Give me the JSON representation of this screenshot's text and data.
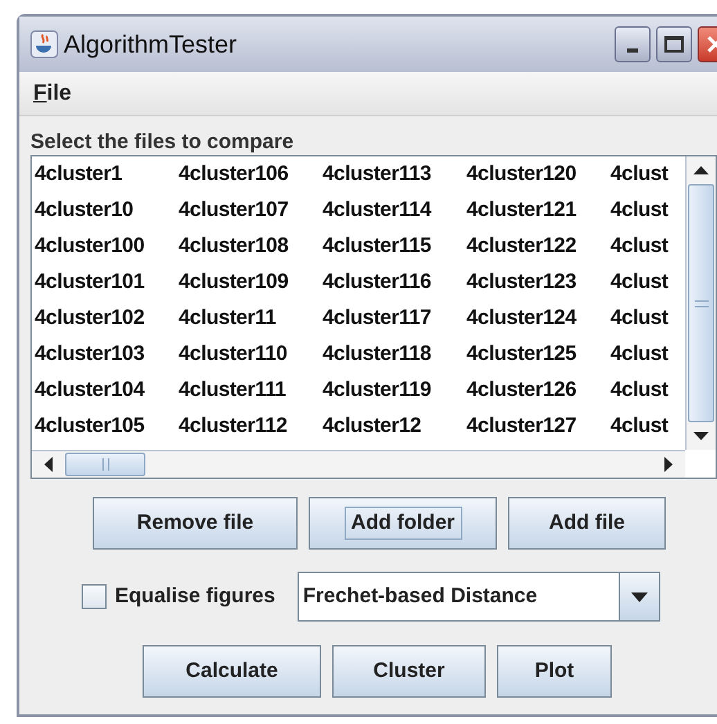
{
  "window": {
    "title": "AlgorithmTester"
  },
  "menu": [
    {
      "label": "File"
    }
  ],
  "list_label": "Select the files to compare",
  "file_list": {
    "columns": [
      [
        "4cluster1",
        "4cluster10",
        "4cluster100",
        "4cluster101",
        "4cluster102",
        "4cluster103",
        "4cluster104",
        "4cluster105"
      ],
      [
        "4cluster106",
        "4cluster107",
        "4cluster108",
        "4cluster109",
        "4cluster11",
        "4cluster110",
        "4cluster111",
        "4cluster112"
      ],
      [
        "4cluster113",
        "4cluster114",
        "4cluster115",
        "4cluster116",
        "4cluster117",
        "4cluster118",
        "4cluster119",
        "4cluster12"
      ],
      [
        "4cluster120",
        "4cluster121",
        "4cluster122",
        "4cluster123",
        "4cluster124",
        "4cluster125",
        "4cluster126",
        "4cluster127"
      ],
      [
        "4clust",
        "4clust",
        "4clust",
        "4clust",
        "4clust",
        "4clust",
        "4clust",
        "4clust"
      ]
    ]
  },
  "file_buttons": [
    {
      "label": "Remove file",
      "focused": false
    },
    {
      "label": "Add folder",
      "focused": true
    },
    {
      "label": "Add file",
      "focused": false
    }
  ],
  "equalise": {
    "label": "Equalise figures",
    "checked": false
  },
  "method_dropdown": {
    "value": "Frechet-based Distance"
  },
  "action_buttons": [
    {
      "label": "Calculate",
      "focused": false
    },
    {
      "label": "Cluster",
      "focused": false
    },
    {
      "label": "Plot",
      "focused": false
    }
  ]
}
